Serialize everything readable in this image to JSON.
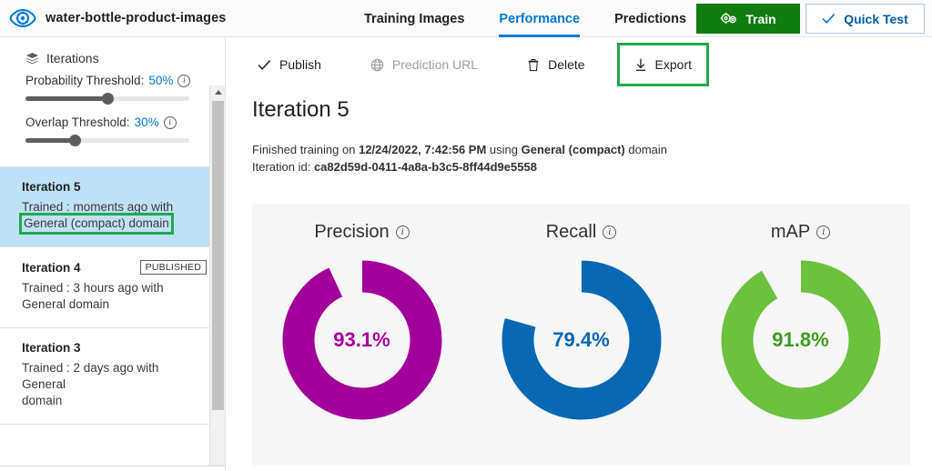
{
  "header": {
    "logo_icon": "eye-gear-icon",
    "project_name": "water-bottle-product-images",
    "tabs": [
      {
        "label": "Training Images",
        "active": false
      },
      {
        "label": "Performance",
        "active": true
      },
      {
        "label": "Predictions",
        "active": false
      }
    ],
    "train_button": {
      "label": "Train",
      "icon": "gears-icon",
      "color": "#107c10"
    },
    "quick_test_button": {
      "label": "Quick Test",
      "icon": "check-icon",
      "color": "#005a9e"
    }
  },
  "sidebar": {
    "section_title": "Iterations",
    "section_icon": "layers-icon",
    "thresholds": [
      {
        "label": "Probability Threshold:",
        "value": "50%",
        "percent": 50,
        "info_icon": "info-icon"
      },
      {
        "label": "Overlap Threshold:",
        "value": "30%",
        "percent": 30,
        "info_icon": "info-icon"
      }
    ],
    "iterations": [
      {
        "title": "Iteration 5",
        "sub_prefix": "Trained : moments ago with",
        "sub_highlight": "General (compact) domain",
        "selected": true,
        "published": false,
        "highlighted": true
      },
      {
        "title": "Iteration 4",
        "sub_prefix": "Trained : 3 hours ago with",
        "sub_highlight": "General domain",
        "selected": false,
        "published": true,
        "published_label": "PUBLISHED",
        "highlighted": false
      },
      {
        "title": "Iteration 3",
        "sub_prefix": "Trained : 2 days ago with General",
        "sub_highlight": "domain",
        "selected": false,
        "published": false,
        "highlighted": false
      }
    ],
    "scrollbar": {
      "up_arrow_icon": "caret-up-icon"
    }
  },
  "commandbar": {
    "publish": {
      "label": "Publish",
      "icon": "check-icon",
      "disabled": false
    },
    "prediction_url": {
      "label": "Prediction URL",
      "icon": "globe-icon",
      "disabled": true
    },
    "delete": {
      "label": "Delete",
      "icon": "trash-icon",
      "disabled": false
    },
    "export": {
      "label": "Export",
      "icon": "download-icon",
      "disabled": false,
      "highlighted": true
    }
  },
  "content": {
    "page_title": "Iteration 5",
    "meta_line1_pre": "Finished training on ",
    "meta_line1_date": "12/24/2022, 7:42:56 PM",
    "meta_line1_mid": " using ",
    "meta_line1_domain": "General (compact)",
    "meta_line1_post": " domain",
    "meta_line2_label": "Iteration id: ",
    "meta_line2_value": "ca82d59d-0411-4a8a-b3c5-8ff44d9e5558"
  },
  "chart_data": [
    {
      "type": "pie",
      "title": "Precision",
      "info_icon": "info-icon",
      "value_label": "93.1%",
      "value": 93.1,
      "max": 100,
      "color": "#a3009b",
      "track_color": "#f7f7f7",
      "units": "%"
    },
    {
      "type": "pie",
      "title": "Recall",
      "info_icon": "info-icon",
      "value_label": "79.4%",
      "value": 79.4,
      "max": 100,
      "color": "#0868b3",
      "track_color": "#f7f7f7",
      "units": "%"
    },
    {
      "type": "pie",
      "title": "mAP",
      "info_icon": "info-icon",
      "value_label": "91.8%",
      "value": 91.8,
      "max": 100,
      "color": "#6cc23f",
      "track_color": "#f7f7f7",
      "units": "%"
    }
  ],
  "colors": {
    "accent": "#0078d4",
    "train_green": "#107c10",
    "highlight_green": "#21a94a",
    "selected_row": "#bfe1f7"
  }
}
